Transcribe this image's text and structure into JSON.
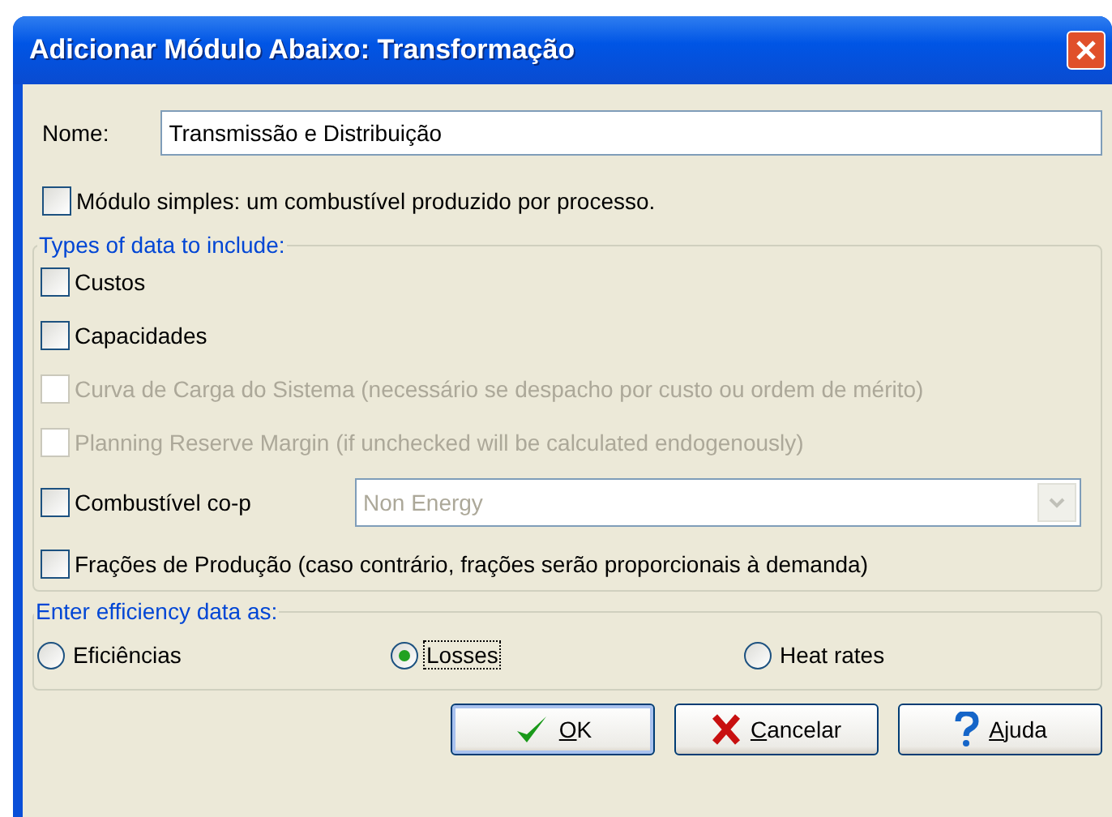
{
  "window": {
    "title": "Adicionar Módulo Abaixo: Transformação"
  },
  "name_field": {
    "label": "Nome:",
    "value": "Transmissão e Distribuição"
  },
  "simple_module": {
    "label": "Módulo simples: um combustível produzido por processo.",
    "checked": false,
    "disabled": false
  },
  "data_types": {
    "title": "Types of data to include:",
    "items": [
      {
        "kind": "checkbox",
        "label": "Custos",
        "checked": false,
        "disabled": false
      },
      {
        "kind": "checkbox",
        "label": "Capacidades",
        "checked": false,
        "disabled": false
      },
      {
        "kind": "checkbox",
        "label": "Curva de Carga do Sistema (necessário se despacho por custo ou ordem de mérito)",
        "checked": false,
        "disabled": true
      },
      {
        "kind": "checkbox",
        "label": "Planning Reserve Margin (if unchecked will be calculated endogenously)",
        "checked": false,
        "disabled": true
      },
      {
        "kind": "combo",
        "label": "Combustível co-p",
        "checked": false,
        "disabled": false,
        "combo_value": "Non Energy",
        "combo_disabled": true
      },
      {
        "kind": "checkbox",
        "label": "Frações de Produção (caso contrário, frações serão proporcionais à demanda)",
        "checked": false,
        "disabled": false
      }
    ]
  },
  "efficiency": {
    "title": "Enter efficiency data as:",
    "options": [
      {
        "label": "Eficiências",
        "selected": false
      },
      {
        "label": "Losses",
        "selected": true
      },
      {
        "label": "Heat rates",
        "selected": false
      }
    ]
  },
  "buttons": [
    {
      "kind": "ok",
      "label": "OK",
      "mnemonic": true
    },
    {
      "kind": "cancel",
      "label": "Cancelar",
      "mnemonic": true
    },
    {
      "kind": "help",
      "label": "Ajuda",
      "mnemonic": true
    }
  ]
}
